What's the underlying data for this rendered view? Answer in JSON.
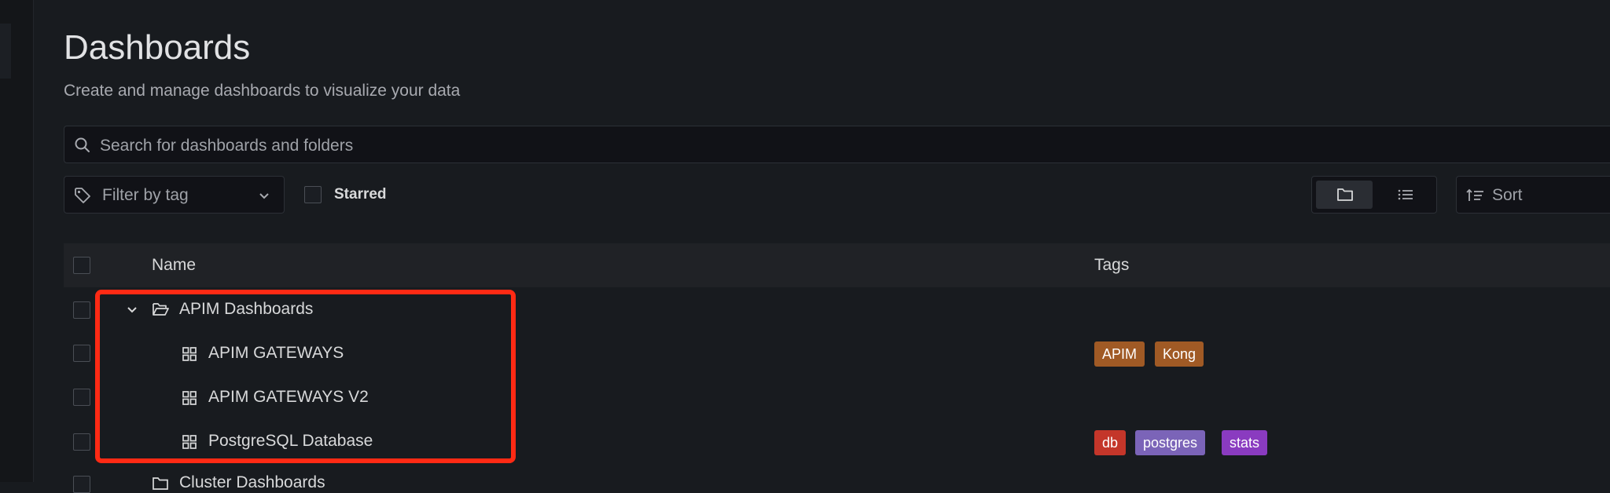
{
  "page": {
    "title": "Dashboards",
    "subtitle": "Create and manage dashboards to visualize your data"
  },
  "search": {
    "placeholder": "Search for dashboards and folders"
  },
  "filter": {
    "label": "Filter by tag"
  },
  "starred": {
    "label": "Starred",
    "checked": false
  },
  "view_toggle": {
    "active": "folder-view"
  },
  "sort": {
    "label": "Sort"
  },
  "table": {
    "columns": [
      "Name",
      "Tags"
    ],
    "rows": [
      {
        "type": "folder",
        "name": "APIM Dashboards",
        "expanded": true,
        "tags": []
      },
      {
        "type": "dashboard",
        "name": "APIM GATEWAYS",
        "tags": [
          {
            "label": "APIM",
            "color": "#a05a25"
          },
          {
            "label": "Kong",
            "color": "#a05a25"
          }
        ]
      },
      {
        "type": "dashboard",
        "name": "APIM GATEWAYS V2",
        "tags": []
      },
      {
        "type": "dashboard",
        "name": "PostgreSQL Database",
        "tags": [
          {
            "label": "db",
            "color": "#c4362a"
          },
          {
            "label": "postgres",
            "color": "#7b64b8"
          },
          {
            "label": "stats",
            "color": "#8a3bc0"
          }
        ]
      },
      {
        "type": "folder",
        "name": "Cluster Dashboards",
        "partially_visible": true,
        "tags": []
      }
    ]
  },
  "colors": {
    "background": "#181b1f",
    "highlight": "#ff2a14"
  }
}
